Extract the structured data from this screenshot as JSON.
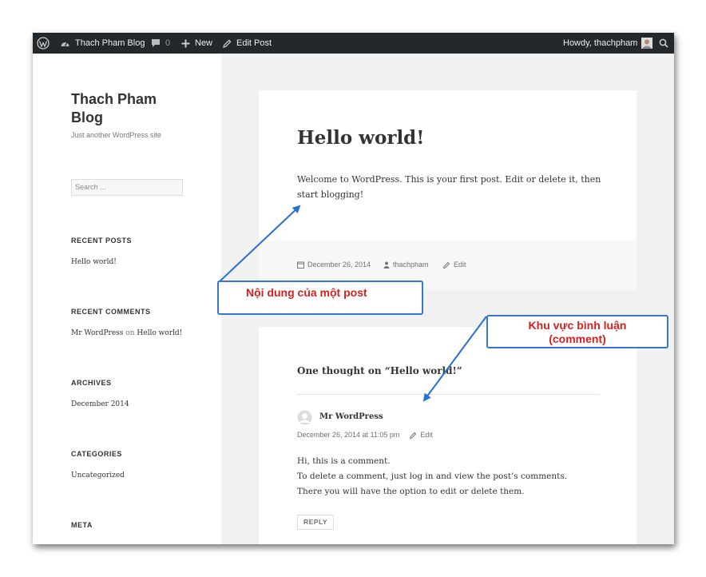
{
  "admin_bar": {
    "site_name": "Thach Pham Blog",
    "comments_count": "0",
    "new_label": "New",
    "edit_post_label": "Edit Post",
    "greeting": "Howdy, thachpham"
  },
  "sidebar": {
    "site_title": "Thach Pham Blog",
    "site_description": "Just another WordPress site",
    "search_placeholder": "Search ...",
    "recent_posts": {
      "heading": "RECENT POSTS",
      "items": [
        "Hello world!"
      ]
    },
    "recent_comments": {
      "heading": "RECENT COMMENTS",
      "author": "Mr WordPress",
      "on": "on",
      "post": "Hello world!"
    },
    "archives": {
      "heading": "ARCHIVES",
      "items": [
        "December 2014"
      ]
    },
    "categories": {
      "heading": "CATEGORIES",
      "items": [
        "Uncategorized"
      ]
    },
    "meta": {
      "heading": "META"
    }
  },
  "post": {
    "title": "Hello world!",
    "body": "Welcome to WordPress. This is your first post. Edit or delete it, then start blogging!",
    "date": "December 26, 2014",
    "author": "thachpham",
    "edit_label": "Edit"
  },
  "comments": {
    "title": "One thought on “Hello world!”",
    "author": "Mr WordPress",
    "datetime": "December 26, 2014 at 11:05 pm",
    "edit_label": "Edit",
    "lines": [
      "Hi, this is a comment.",
      "To delete a comment, just log in and view the post’s comments.",
      "There you will have the option to edit or delete them."
    ],
    "reply_label": "REPLY"
  },
  "annotations": {
    "post_content": "Nội dung của một post",
    "comment_area_line1": "Khu vực bình luận",
    "comment_area_line2": "(comment)"
  },
  "colors": {
    "admin_bar_bg": "#23282d",
    "callout_border": "#3876d6",
    "callout_text": "#d71f1f"
  },
  "icons": [
    "wordpress-logo-icon",
    "dashboard-icon",
    "comment-bubble-icon",
    "plus-icon",
    "pencil-icon",
    "avatar-icon",
    "search-icon",
    "calendar-icon",
    "person-icon",
    "gravatar-icon"
  ]
}
